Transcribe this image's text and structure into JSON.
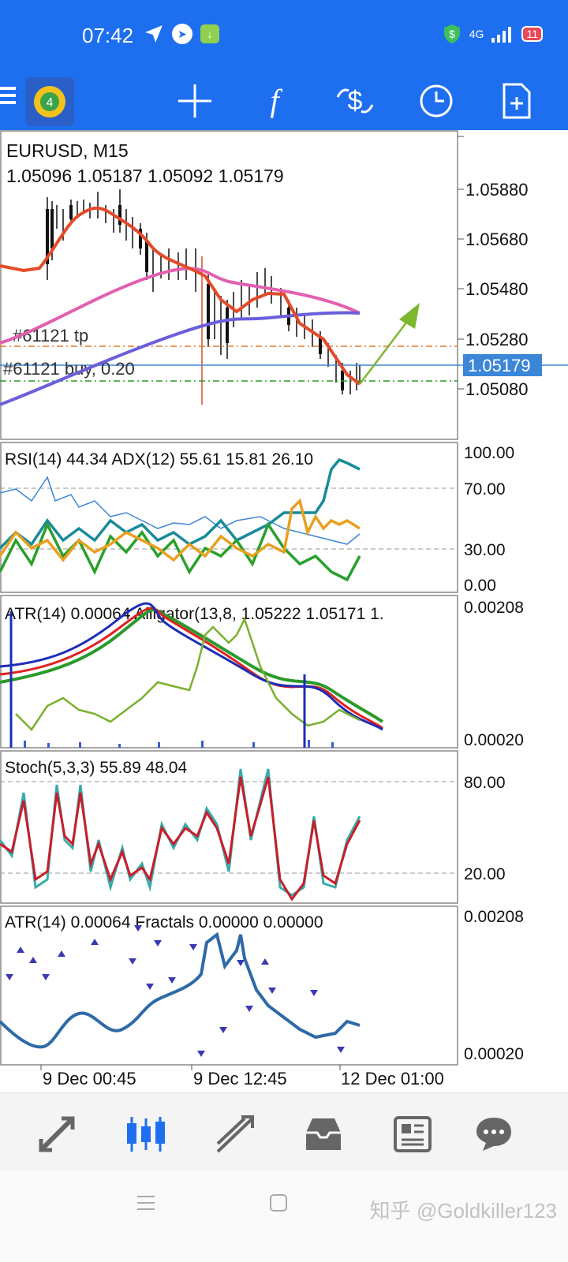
{
  "status_bar": {
    "time": "07:42",
    "battery": "11",
    "network_label": "4G"
  },
  "chart": {
    "symbol": "EURUSD, M15",
    "ohlc": "1.05096 1.05187 1.05092 1.05179",
    "price_levels": [
      "1.05880",
      "1.05680",
      "1.05480",
      "1.05280",
      "1.05080"
    ],
    "current_price": "1.05179",
    "tp_label": "#61121 tp",
    "buy_label": "#61121 buy, 0.20",
    "colors": {
      "tp_line": "#e6782a",
      "buy_line": "#2a9a2a",
      "current_line": "#3c86d8",
      "ma_pink": "#e35fb0",
      "ma_violet": "#6b5fdc",
      "price_ma": "#e44b2a",
      "arrow": "#7cb82f"
    }
  },
  "indicators": [
    {
      "label": "RSI(14) 44.34 ADX(12) 55.61 15.81 26.10",
      "levels": [
        "100.00",
        "70.00",
        "30.00",
        "0.00"
      ]
    },
    {
      "label": "ATR(14) 0.00064 Alligator(13,8, 1.05222 1.05171 1.",
      "levels": [
        "0.00208",
        "0.00020"
      ]
    },
    {
      "label": "Stoch(5,3,3) 55.89 48.04",
      "levels": [
        "80.00",
        "20.00"
      ]
    },
    {
      "label": "ATR(14) 0.00064 Fractals 0.00000 0.00000",
      "levels": [
        "0.00208",
        "0.00020"
      ]
    }
  ],
  "time_axis": [
    "9 Dec 00:45",
    "9 Dec 12:45",
    "12 Dec 01:00"
  ],
  "watermark": "知乎 @Goldkiller123",
  "nav": {
    "items": [
      {
        "name": "quotes",
        "icon": "trend-arrows-icon"
      },
      {
        "name": "chart",
        "icon": "candlestick-icon"
      },
      {
        "name": "trade",
        "icon": "line-trend-icon"
      },
      {
        "name": "history",
        "icon": "inbox-icon"
      },
      {
        "name": "news",
        "icon": "newspaper-icon"
      },
      {
        "name": "messages",
        "icon": "chat-bubble-icon"
      }
    ]
  }
}
